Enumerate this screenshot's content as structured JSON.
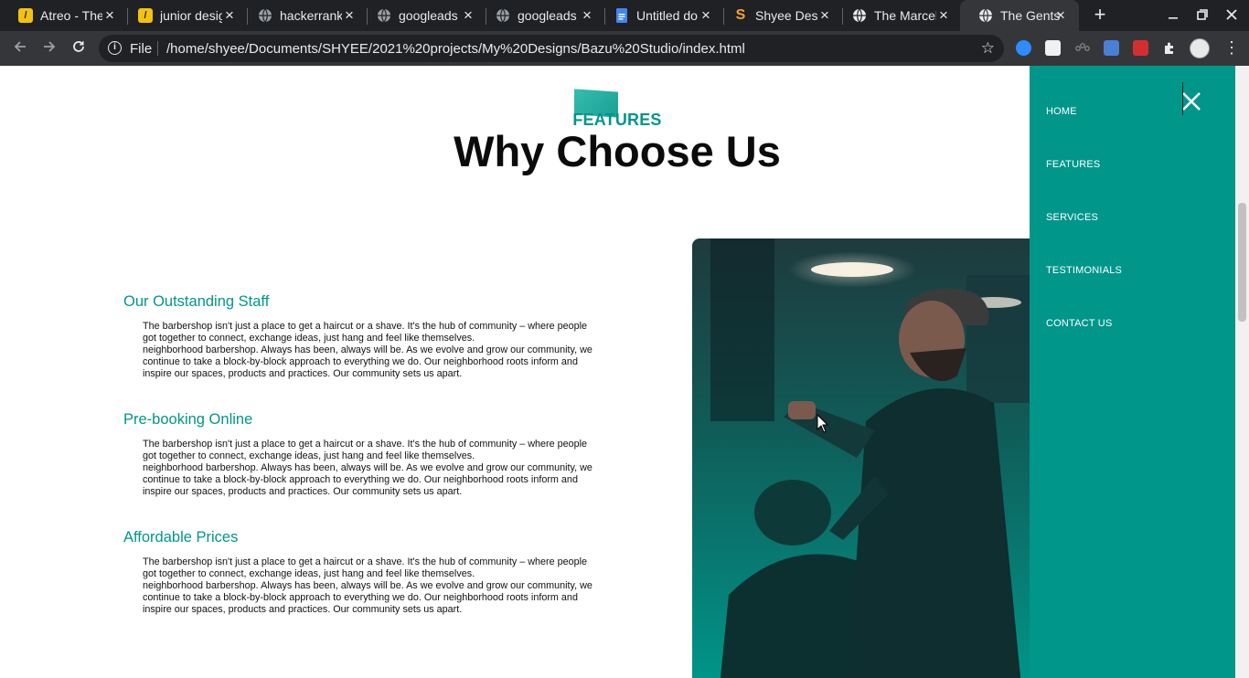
{
  "tabs": [
    {
      "title": "Atreo - The",
      "icon": "atreo-favicon-icon",
      "color": "#f4c20d",
      "glyph": "(/"
    },
    {
      "title": "junior desig",
      "icon": "atreo-favicon-icon",
      "color": "#f4c20d",
      "glyph": "(/"
    },
    {
      "title": "hackerrank",
      "icon": "globe-icon",
      "color": "",
      "glyph": ""
    },
    {
      "title": "googleads",
      "icon": "globe-icon",
      "color": "",
      "glyph": ""
    },
    {
      "title": "googleads",
      "icon": "globe-icon",
      "color": "",
      "glyph": ""
    },
    {
      "title": "Untitled do",
      "icon": "google-docs-icon",
      "color": "#4285f4",
      "glyph": ""
    },
    {
      "title": "Shyee Desi",
      "icon": "s-logo-icon",
      "color": "#f5a623",
      "glyph": "S"
    },
    {
      "title": "The Marcel",
      "icon": "globe-icon",
      "color": "",
      "glyph": ""
    },
    {
      "title": "The Gents",
      "icon": "globe-icon",
      "color": "",
      "glyph": "",
      "active": true
    }
  ],
  "toolbar": {
    "scheme": "File",
    "url": "/home/shyee/Documents/SHYEE/2021%20projects/My%20Designs/Bazu%20Studio/index.html"
  },
  "page": {
    "section_label": "FEATURES",
    "section_title": "Why Choose Us",
    "features": [
      {
        "title": "Our Outstanding Staff",
        "body": "The barbershop isn't just a place to get a haircut or a shave. It's the hub of community – where people got together to connect, exchange ideas, just hang and feel like themselves.\nneighborhood barbershop. Always has been, always will be. As we evolve and grow our community, we continue to take a block-by-block approach to everything we do. Our neighborhood roots inform and inspire our spaces, products and practices. Our community sets us apart."
      },
      {
        "title": "Pre-booking Online",
        "body": "The barbershop isn't just a place to get a haircut or a shave. It's the hub of community – where people got together to connect, exchange ideas, just hang and feel like themselves.\nneighborhood barbershop. Always has been, always will be. As we evolve and grow our community, we continue to take a block-by-block approach to everything we do. Our neighborhood roots inform and inspire our spaces, products and practices. Our community sets us apart."
      },
      {
        "title": "Affordable Prices",
        "body": "The barbershop isn't just a place to get a haircut or a shave. It's the hub of community – where people got together to connect, exchange ideas, just hang and feel like themselves.\nneighborhood barbershop. Always has been, always will be. As we evolve and grow our community, we continue to take a block-by-block approach to everything we do. Our neighborhood roots inform and inspire our spaces, products and practices. Our community sets us apart."
      }
    ]
  },
  "sidenav": {
    "items": [
      "HOME",
      "FEATURES",
      "SERVICES",
      "TESTIMONIALS",
      "CONTACT US"
    ]
  },
  "colors": {
    "accent": "#00968a",
    "title": "#0b0b0b",
    "chrome_dark": "#202124",
    "chrome_mid": "#35363a"
  }
}
